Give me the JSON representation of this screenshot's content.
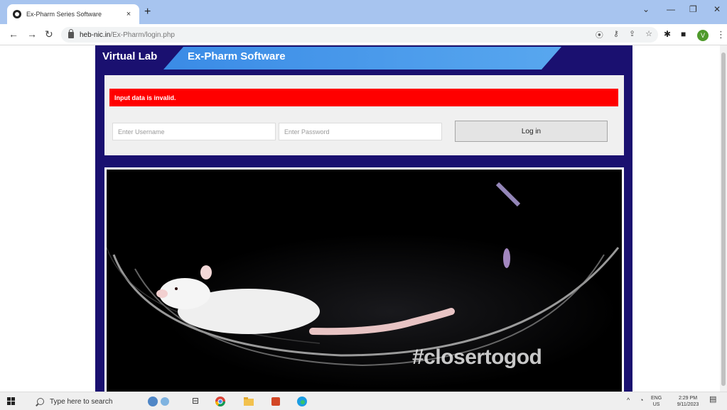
{
  "browser": {
    "tab_title": "Ex-Pharm Series Software",
    "tab_close": "×",
    "new_tab": "+",
    "url_host": "heb-nic.in",
    "url_path": "/Ex-Pharm/login.php",
    "profile_initial": "V"
  },
  "site": {
    "brand": "Virtual Lab",
    "app_title": "Ex-Pharm Software",
    "error_message": "Input data is invalid.",
    "username_placeholder": "Enter Username",
    "password_placeholder": "Enter Password",
    "username_value": "",
    "password_value": "",
    "login_label": "Log in",
    "video_caption": "#closertogod"
  },
  "taskbar": {
    "search_placeholder": "Type here to search",
    "lang_top": "ENG",
    "lang_bottom": "US",
    "time": "2:29 PM",
    "date": "9/11/2023"
  },
  "colors": {
    "site_bg": "#1a1070",
    "band": "#4a9ae9",
    "error": "#ff0000",
    "panel": "#f0f0f0"
  },
  "icons": [
    "favicon-icon",
    "back-arrow-icon",
    "forward-arrow-icon",
    "reload-icon",
    "lock-icon",
    "location-icon",
    "key-icon",
    "share-icon",
    "star-icon",
    "extensions-icon",
    "sidebar-icon",
    "menu-icon",
    "windows-icon",
    "search-icon",
    "chrome-icon",
    "explorer-icon",
    "office-icon",
    "edge-icon",
    "notification-icon"
  ]
}
